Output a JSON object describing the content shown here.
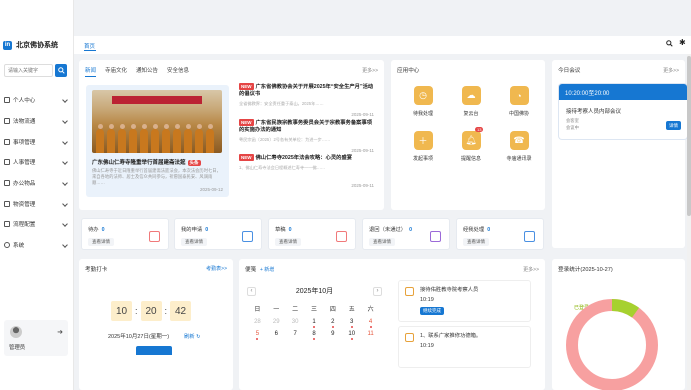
{
  "brand": {
    "name": "北京佛协系统",
    "logo": "in"
  },
  "search": {
    "placeholder": "请输入关键字"
  },
  "menu": [
    {
      "label": "个人中心",
      "icon": "monitor-icon"
    },
    {
      "label": "法物流通",
      "icon": "bookmark-icon"
    },
    {
      "label": "事项管理",
      "icon": "document-icon"
    },
    {
      "label": "人事管理",
      "icon": "user-icon"
    },
    {
      "label": "办公物品",
      "icon": "box-icon"
    },
    {
      "label": "物资管理",
      "icon": "box-icon"
    },
    {
      "label": "流程配置",
      "icon": "flow-icon"
    },
    {
      "label": "系统",
      "icon": "gear-icon"
    }
  ],
  "user": {
    "name": "管理员"
  },
  "top": {
    "home_tab": "首页"
  },
  "news": {
    "tabs": [
      "新闻",
      "寺庙文化",
      "通知公告",
      "安全信息"
    ],
    "more": "更多>>",
    "feature": {
      "title": "广东佛山仁寿寺隆重举行首届建斋法筵",
      "badge": "头条",
      "desc": "佛山仁寿寺于近日隆重举行首届建斋法筵法会，本次法会历时七日，来自各地的法师、居士及信众共同参与，祈愿国泰民安、风调雨顺……",
      "date": "2025-09-12"
    },
    "items": [
      {
        "tag": "NEW",
        "title": "广东省佛教协会关于开展2025年“安全生产月”活动的倡议书",
        "desc": "全省佛教界：安全责任重于泰山。2025年……",
        "date": "2025-09-11"
      },
      {
        "tag": "NEW",
        "title": "广东省民族宗教事务委员会关于宗教事务备案事项的实施办法的通知",
        "desc": "粤民宗函〔2025〕2号各有关单位：为进一步……",
        "date": "2025-09-11"
      },
      {
        "tag": "NEW",
        "title": "佛山仁寿寺2025年法会攻略：心灵的盛宴",
        "desc": "1、佛山仁寿寺法会日程概述仁寿寺——佛……",
        "date": "2025-09-11"
      }
    ]
  },
  "apps": {
    "title": "应用中心",
    "items": [
      {
        "label": "待我处理",
        "icon": "clock-icon",
        "color": "#f0b84f"
      },
      {
        "label": "复云台",
        "icon": "cloud-icon",
        "color": "#f0b84f"
      },
      {
        "label": "中国佛协",
        "icon": "pie-icon",
        "color": "#f0b84f"
      },
      {
        "label": "发起事项",
        "icon": "plus-icon",
        "color": "#f0b84f"
      },
      {
        "label": "提醒信息",
        "icon": "bell-icon",
        "color": "#f0b84f",
        "badge": "13"
      },
      {
        "label": "寺庙通讯录",
        "icon": "phone-icon",
        "color": "#f0b84f"
      }
    ]
  },
  "meeting": {
    "title": "今日会议",
    "more": "更多>>",
    "time": "10:20:00至20:00",
    "name": "接待考察人员内部会议",
    "place": "会客室",
    "room": "会议中",
    "button": "详情"
  },
  "stats": [
    {
      "label": "待办",
      "count": "0",
      "button": "查看详情",
      "color": "#f0797a"
    },
    {
      "label": "我的申请",
      "count": "0",
      "button": "查看详情",
      "color": "#4a90e2"
    },
    {
      "label": "草稿",
      "count": "0",
      "button": "查看详情",
      "color": "#f0797a"
    },
    {
      "label": "退回（未通过）",
      "count": "0",
      "button": "查看详情",
      "color": "#9b6ad8"
    },
    {
      "label": "经我处理",
      "count": "0",
      "button": "查看详情",
      "color": "#4a90e2"
    }
  ],
  "attendance": {
    "title": "考勤打卡",
    "link": "考勤表>>",
    "hh": "10",
    "mm": "20",
    "ss": "42",
    "date": "2025年10月27日(星期一)",
    "refresh": "刷新"
  },
  "notes": {
    "title": "便笺",
    "add": "+ 新增",
    "more": "更多>>",
    "month": "2025年10月",
    "weekdays": [
      "日",
      "一",
      "二",
      "三",
      "四",
      "五",
      "六"
    ],
    "days": [
      {
        "d": "28",
        "cls": "dim"
      },
      {
        "d": "29",
        "cls": "dim"
      },
      {
        "d": "30",
        "cls": "dim"
      },
      {
        "d": "1",
        "cls": "dot"
      },
      {
        "d": "2",
        "cls": "dot"
      },
      {
        "d": "3",
        "cls": "dot"
      },
      {
        "d": "4",
        "cls": "we dot"
      },
      {
        "d": "5",
        "cls": "we dot"
      },
      {
        "d": "6",
        "cls": ""
      },
      {
        "d": "7",
        "cls": ""
      },
      {
        "d": "8",
        "cls": "dot"
      },
      {
        "d": "9",
        "cls": ""
      },
      {
        "d": "10",
        "cls": "dot"
      },
      {
        "d": "11",
        "cls": "we"
      }
    ],
    "todos": [
      {
        "title": "接待佑胜教寺院考察人员",
        "time": "10:19",
        "tag": "继续完成"
      },
      {
        "title": "1、联系广家推修功德箱。",
        "time": "10:19",
        "tag": ""
      }
    ]
  },
  "login_stats": {
    "title": "登录统计(2025-10-27)",
    "legend": "已登录",
    "logged_fraction": 0.1,
    "colors": {
      "logged": "#a6d12f",
      "other": "#f7a0a0"
    }
  },
  "colors": {
    "accent": "#1677d2",
    "badge": "#e54545"
  }
}
